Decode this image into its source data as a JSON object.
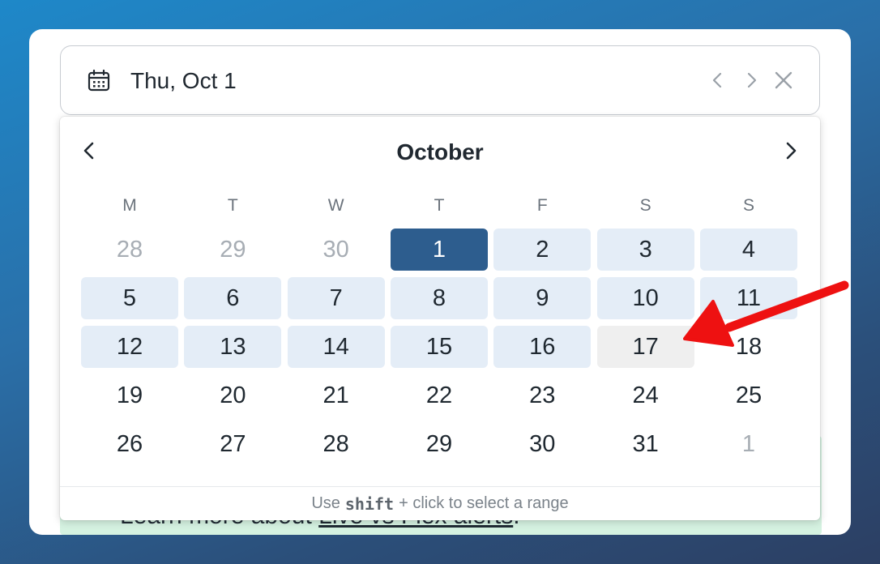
{
  "date_input": {
    "value": "Thu, Oct 1",
    "icon": "calendar-icon",
    "controls": [
      "chevron-left-icon",
      "chevron-right-icon",
      "close-icon"
    ]
  },
  "calendar": {
    "month": "October",
    "weekdays": [
      "M",
      "T",
      "W",
      "T",
      "F",
      "S",
      "S"
    ],
    "days": [
      {
        "label": "28",
        "state": "muted"
      },
      {
        "label": "29",
        "state": "muted"
      },
      {
        "label": "30",
        "state": "muted"
      },
      {
        "label": "1",
        "state": "selected"
      },
      {
        "label": "2",
        "state": "in-range"
      },
      {
        "label": "3",
        "state": "in-range"
      },
      {
        "label": "4",
        "state": "in-range"
      },
      {
        "label": "5",
        "state": "in-range"
      },
      {
        "label": "6",
        "state": "in-range"
      },
      {
        "label": "7",
        "state": "in-range"
      },
      {
        "label": "8",
        "state": "in-range"
      },
      {
        "label": "9",
        "state": "in-range"
      },
      {
        "label": "10",
        "state": "in-range"
      },
      {
        "label": "11",
        "state": "in-range"
      },
      {
        "label": "12",
        "state": "in-range"
      },
      {
        "label": "13",
        "state": "in-range"
      },
      {
        "label": "14",
        "state": "in-range"
      },
      {
        "label": "15",
        "state": "in-range"
      },
      {
        "label": "16",
        "state": "in-range"
      },
      {
        "label": "17",
        "state": "hover"
      },
      {
        "label": "18",
        "state": "normal"
      },
      {
        "label": "19",
        "state": "normal"
      },
      {
        "label": "20",
        "state": "normal"
      },
      {
        "label": "21",
        "state": "normal"
      },
      {
        "label": "22",
        "state": "normal"
      },
      {
        "label": "23",
        "state": "normal"
      },
      {
        "label": "24",
        "state": "normal"
      },
      {
        "label": "25",
        "state": "normal"
      },
      {
        "label": "26",
        "state": "normal"
      },
      {
        "label": "27",
        "state": "normal"
      },
      {
        "label": "28",
        "state": "normal"
      },
      {
        "label": "29",
        "state": "normal"
      },
      {
        "label": "30",
        "state": "normal"
      },
      {
        "label": "31",
        "state": "normal"
      },
      {
        "label": "1",
        "state": "muted"
      }
    ],
    "footer": {
      "prefix": "Use",
      "key": "shift",
      "suffix": "+ click to select a range"
    }
  },
  "background_alert": {
    "prefix": "Learn more about ",
    "link": "Live vs Flex alerts",
    "suffix": "."
  },
  "colors": {
    "selected": "#2d5d8e",
    "range": "#e4edf7",
    "hover": "#efefef",
    "annotation_arrow": "#ee1111"
  }
}
